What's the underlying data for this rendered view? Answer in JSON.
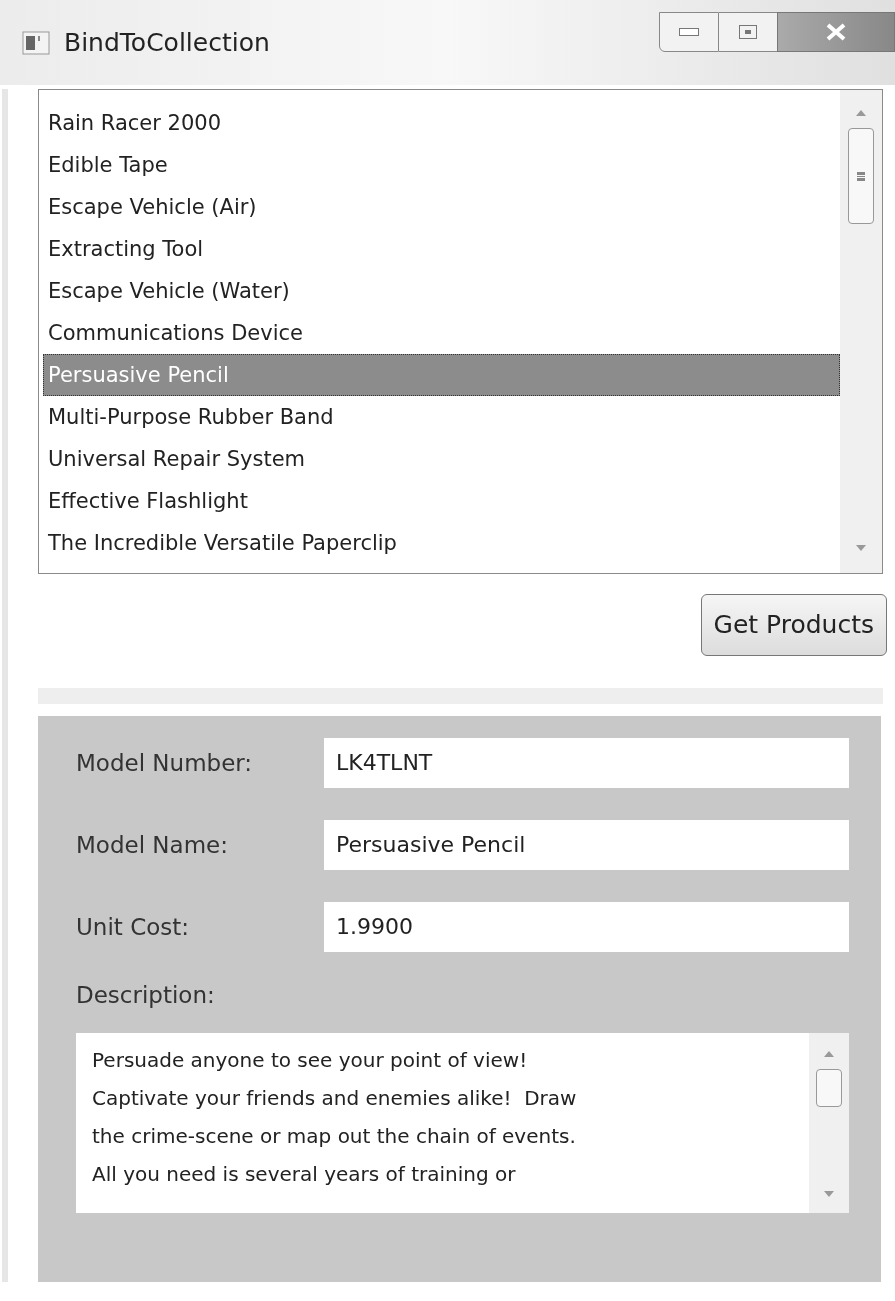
{
  "window": {
    "title": "BindToCollection"
  },
  "products": [
    {
      "label": "Rain Racer 2000",
      "selected": false
    },
    {
      "label": "Edible Tape",
      "selected": false
    },
    {
      "label": "Escape Vehicle (Air)",
      "selected": false
    },
    {
      "label": "Extracting Tool",
      "selected": false
    },
    {
      "label": "Escape Vehicle (Water)",
      "selected": false
    },
    {
      "label": "Communications Device",
      "selected": false
    },
    {
      "label": "Persuasive Pencil",
      "selected": true
    },
    {
      "label": "Multi-Purpose Rubber Band",
      "selected": false
    },
    {
      "label": "Universal Repair System",
      "selected": false
    },
    {
      "label": "Effective Flashlight",
      "selected": false
    },
    {
      "label": "The Incredible Versatile Paperclip",
      "selected": false
    }
  ],
  "get_button": "Get Products",
  "details": {
    "fields": [
      {
        "label": "Model Number:",
        "value": "LK4TLNT"
      },
      {
        "label": "Model Name:",
        "value": "Persuasive Pencil"
      },
      {
        "label": "Unit Cost:",
        "value": "1.9900"
      }
    ],
    "description_label": "Description:",
    "description_lines": [
      "Persuade anyone to see your point of view!",
      "Captivate your friends and enemies alike!  Draw",
      "the crime-scene or map out the chain of events.",
      "All you need is several years of training or"
    ]
  }
}
